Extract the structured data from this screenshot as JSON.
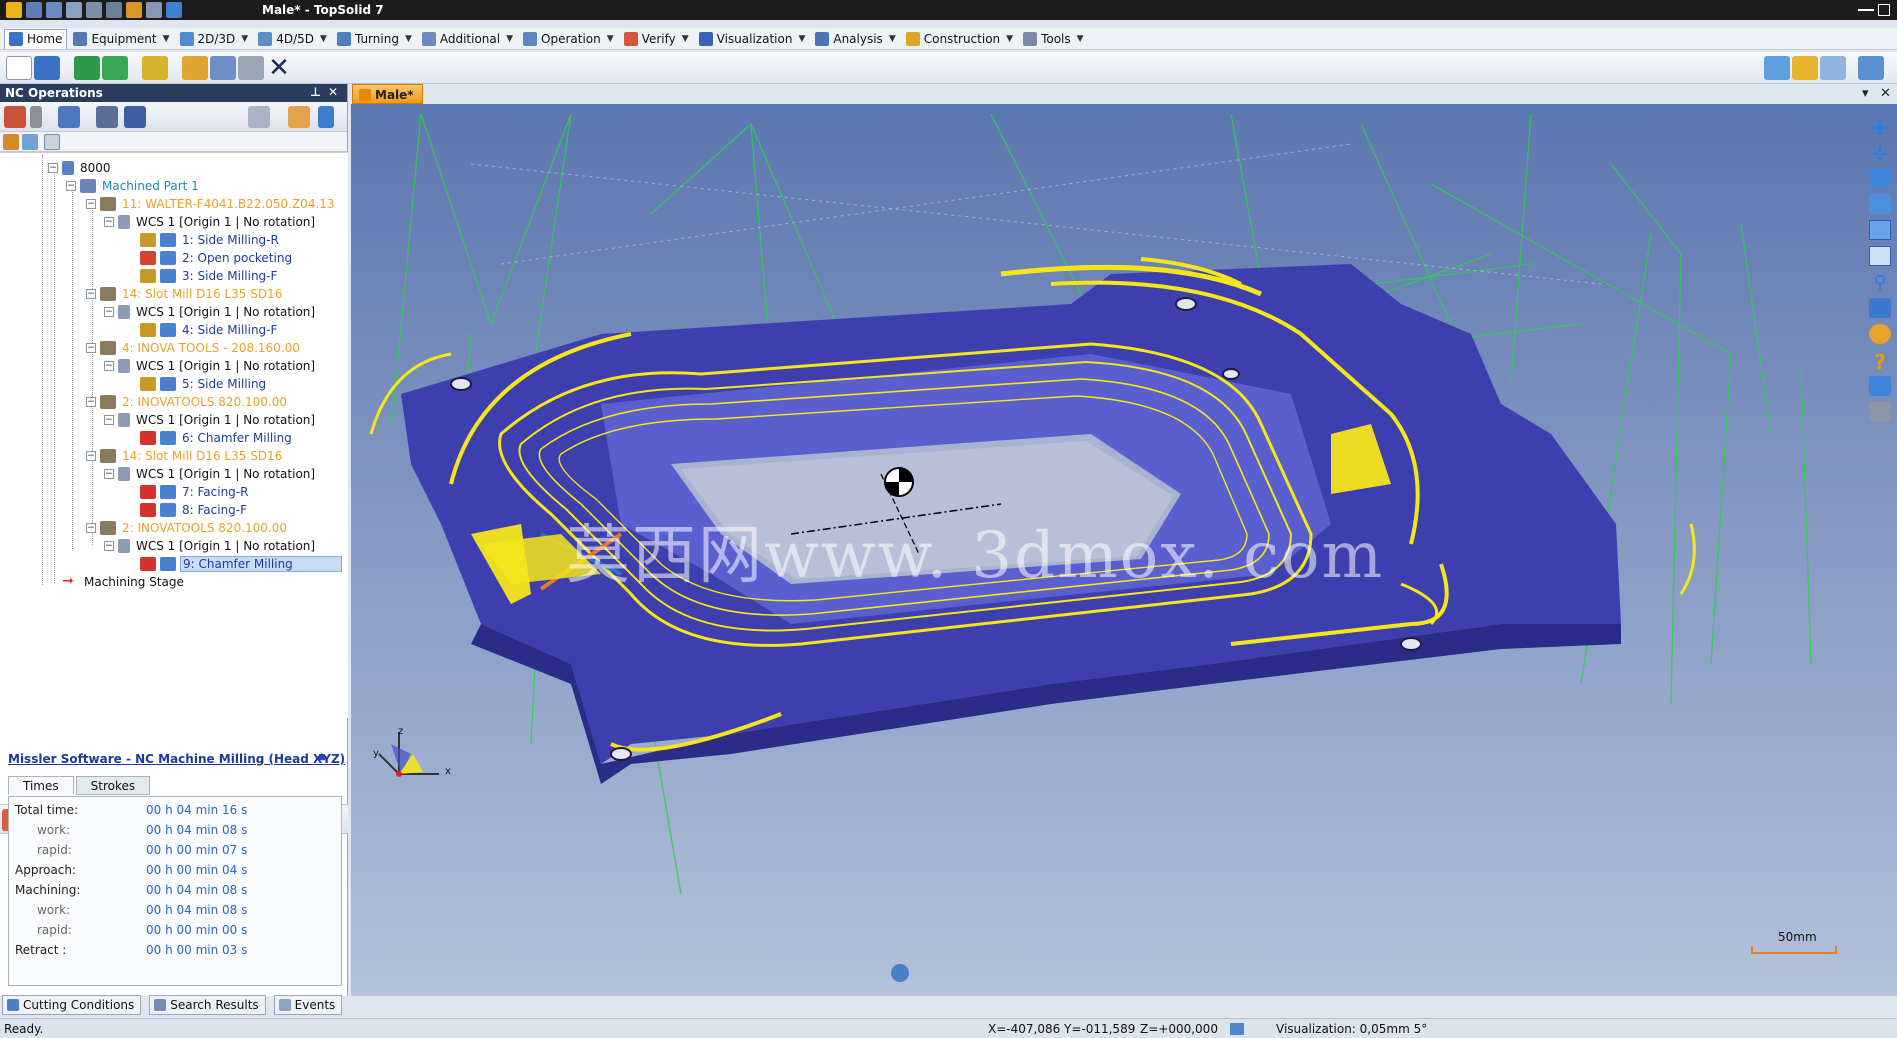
{
  "window": {
    "title": "Male* - TopSolid 7"
  },
  "menu": [
    {
      "label": "Home",
      "icon": "home-icon"
    },
    {
      "label": "Equipment",
      "icon": "equipment-icon"
    },
    {
      "label": "2D/3D",
      "icon": "2d3d-icon"
    },
    {
      "label": "4D/5D",
      "icon": "4d5d-icon"
    },
    {
      "label": "Turning",
      "icon": "turning-icon"
    },
    {
      "label": "Additional",
      "icon": "additional-icon"
    },
    {
      "label": "Operation",
      "icon": "operation-icon"
    },
    {
      "label": "Verify",
      "icon": "verify-icon"
    },
    {
      "label": "Visualization",
      "icon": "visualization-icon"
    },
    {
      "label": "Analysis",
      "icon": "analysis-icon"
    },
    {
      "label": "Construction",
      "icon": "construction-icon"
    },
    {
      "label": "Tools",
      "icon": "tools-icon"
    }
  ],
  "panel": {
    "title": "NC Operations"
  },
  "tree": [
    {
      "label": "8000",
      "level": 0,
      "kind": "wcs"
    },
    {
      "label": "Machined Part 1",
      "level": 1,
      "kind": "part"
    },
    {
      "label": "11: WALTER-F4041.B22.050.Z04.13",
      "level": 2,
      "kind": "tool"
    },
    {
      "label": "WCS 1 [Origin 1 | No rotation]",
      "level": 3,
      "kind": "wcs"
    },
    {
      "label": "1: Side Milling-R",
      "level": 4,
      "kind": "op"
    },
    {
      "label": "2: Open pocketing",
      "level": 4,
      "kind": "op"
    },
    {
      "label": "3: Side Milling-F",
      "level": 4,
      "kind": "op"
    },
    {
      "label": "14: Slot Mill D16 L35 SD16",
      "level": 2,
      "kind": "tool"
    },
    {
      "label": "WCS 1 [Origin 1 | No rotation]",
      "level": 3,
      "kind": "wcs"
    },
    {
      "label": "4: Side Milling-F",
      "level": 4,
      "kind": "op"
    },
    {
      "label": "4: INOVA TOOLS - 208.160.00",
      "level": 2,
      "kind": "tool"
    },
    {
      "label": "WCS 1 [Origin 1 | No rotation]",
      "level": 3,
      "kind": "wcs"
    },
    {
      "label": "5: Side Milling",
      "level": 4,
      "kind": "op"
    },
    {
      "label": "2: INOVATOOLS 820.100.00",
      "level": 2,
      "kind": "tool"
    },
    {
      "label": "WCS 1 [Origin 1 | No rotation]",
      "level": 3,
      "kind": "wcs"
    },
    {
      "label": "6: Chamfer Milling",
      "level": 4,
      "kind": "op"
    },
    {
      "label": "14: Slot Mill D16 L35 SD16",
      "level": 2,
      "kind": "tool"
    },
    {
      "label": "WCS 1 [Origin 1 | No rotation]",
      "level": 3,
      "kind": "wcs"
    },
    {
      "label": "7: Facing-R",
      "level": 4,
      "kind": "op"
    },
    {
      "label": "8: Facing-F",
      "level": 4,
      "kind": "op"
    },
    {
      "label": "2: INOVATOOLS 820.100.00",
      "level": 2,
      "kind": "tool"
    },
    {
      "label": "WCS 1 [Origin 1 | No rotation]",
      "level": 3,
      "kind": "wcs"
    },
    {
      "label": "9: Chamfer Milling",
      "level": 4,
      "kind": "op",
      "selected": true
    },
    {
      "label": "Machining Stage",
      "level": 1,
      "kind": "stage"
    }
  ],
  "machine": {
    "link": "Missler Software - NC Machine Milling (Head XYZ)"
  },
  "tabs": [
    "Times",
    "Strokes"
  ],
  "times": [
    {
      "label": "Total time:",
      "value": "00 h 04 min 16 s",
      "sub": false
    },
    {
      "label": "work:",
      "value": "00 h 04 min 08 s",
      "sub": true
    },
    {
      "label": "rapid:",
      "value": "00 h 00 min 07 s",
      "sub": true
    },
    {
      "label": "Approach:",
      "value": "00 h 00 min 04 s",
      "sub": false
    },
    {
      "label": "Machining:",
      "value": "00 h 04 min 08 s",
      "sub": false
    },
    {
      "label": "work:",
      "value": "00 h 04 min 08 s",
      "sub": true
    },
    {
      "label": "rapid:",
      "value": "00 h 00 min 00 s",
      "sub": true
    },
    {
      "label": "Retract :",
      "value": "00 h 00 min 03 s",
      "sub": false
    }
  ],
  "bottom_tabs": [
    "Cutting Conditions",
    "Search Results",
    "Events"
  ],
  "document_tab": "Male*",
  "viewport": {
    "watermark": "莫西网www. 3dmox. com",
    "axis_x": "x",
    "axis_y": "y",
    "axis_z": "z",
    "scale_label": "50mm"
  },
  "status": {
    "ready": "Ready.",
    "x": "X=-407,086",
    "y": "Y=-011,589",
    "z": "Z=+000,000",
    "visualization": "Visualization: 0,05mm 5°"
  },
  "colors": {
    "part_body": "#4a4fc0",
    "toolpath": "#f5e61a",
    "rapid_moves": "#22cc44",
    "tool_label": "#e8a12a",
    "op_label": "#1f3c9a",
    "panel_header": "#2a3d5c",
    "active_tab": "#f29a1a"
  }
}
